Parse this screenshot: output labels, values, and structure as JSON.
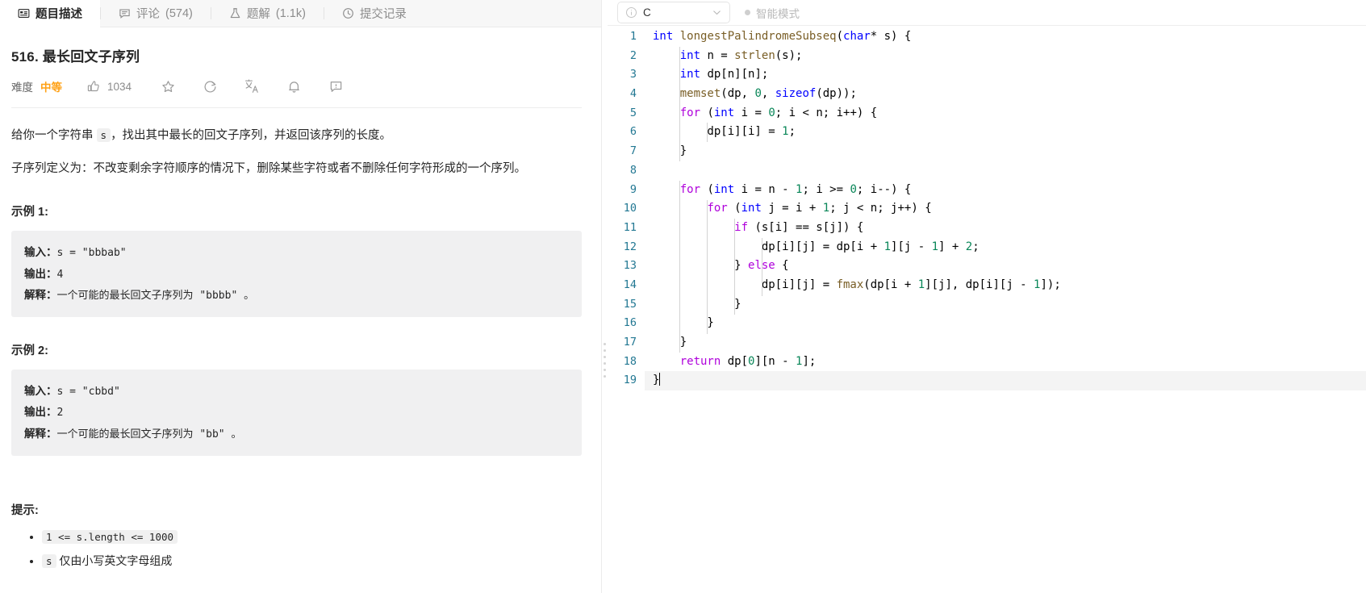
{
  "tabs": [
    {
      "label": "题目描述",
      "icon": "description-icon",
      "count": "",
      "active": true
    },
    {
      "label": "评论",
      "icon": "comment-icon",
      "count": "(574)",
      "active": false
    },
    {
      "label": "题解",
      "icon": "flask-icon",
      "count": "(1.1k)",
      "active": false
    },
    {
      "label": "提交记录",
      "icon": "clock-icon",
      "count": "",
      "active": false
    }
  ],
  "problem": {
    "title": "516. 最长回文子序列",
    "difficulty_label": "难度",
    "difficulty": "中等",
    "likes": "1034",
    "paragraph1_pre": "给你一个字符串",
    "paragraph1_code": "s",
    "paragraph1_post": "，找出其中最长的回文子序列，并返回该序列的长度。",
    "paragraph2": "子序列定义为：不改变剩余字符顺序的情况下，删除某些字符或者不删除任何字符形成的一个序列。",
    "examples": [
      {
        "heading": "示例 1:",
        "input_label": "输入：",
        "input_value": "s = \"bbbab\"",
        "output_label": "输出：",
        "output_value": "4",
        "explain_label": "解释：",
        "explain_value": "一个可能的最长回文子序列为 \"bbbb\" 。"
      },
      {
        "heading": "示例 2:",
        "input_label": "输入：",
        "input_value": "s = \"cbbd\"",
        "output_label": "输出：",
        "output_value": "2",
        "explain_label": "解释：",
        "explain_value": "一个可能的最长回文子序列为 \"bb\" 。"
      }
    ],
    "hints_heading": "提示:",
    "hints": [
      "1 <= s.length <= 1000",
      "s 仅由小写英文字母组成"
    ]
  },
  "editor": {
    "language": "C",
    "smart_mode_label": "智能模式",
    "line_count": 19,
    "lines": [
      "int longestPalindromeSubseq(char* s) {",
      "    int n = strlen(s);",
      "    int dp[n][n];",
      "    memset(dp, 0, sizeof(dp));",
      "    for (int i = 0; i < n; i++) {",
      "        dp[i][i] = 1;",
      "    }",
      "",
      "    for (int i = n - 1; i >= 0; i--) {",
      "        for (int j = i + 1; j < n; j++) {",
      "            if (s[i] == s[j]) {",
      "                dp[i][j] = dp[i + 1][j - 1] + 2;",
      "            } else {",
      "                dp[i][j] = fmax(dp[i + 1][j], dp[i][j - 1]);",
      "            }",
      "        }",
      "    }",
      "    return dp[0][n - 1];",
      "}"
    ],
    "cursor_line": 19
  },
  "colors": {
    "accent_orange": "#ffa116",
    "keyword_blue": "#0000ff",
    "keyword_purple": "#af00db",
    "function_brown": "#795e26",
    "number_green": "#098658",
    "gutter_blue": "#237893"
  }
}
